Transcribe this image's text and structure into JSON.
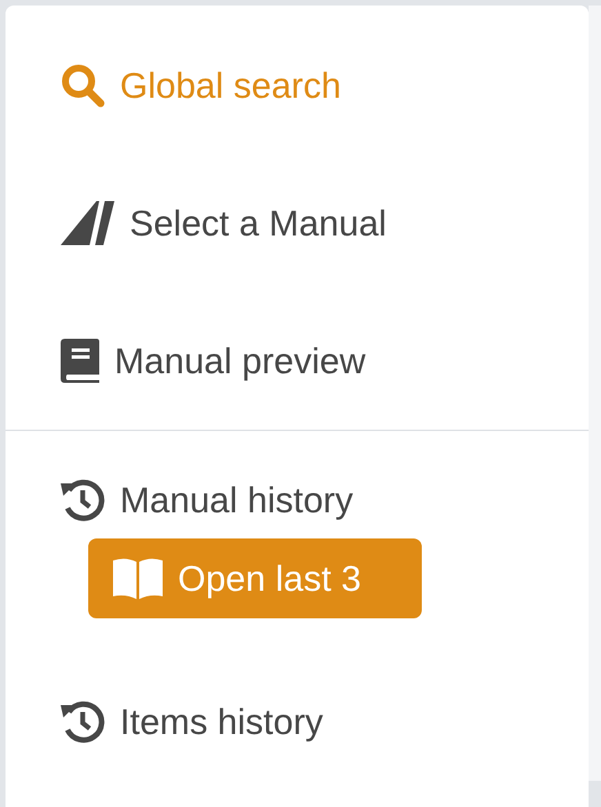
{
  "menu": {
    "groups": [
      {
        "items": [
          {
            "kind": "search",
            "label": "Global search",
            "selected": true
          },
          {
            "kind": "select",
            "label": "Select a Manual",
            "selected": false
          },
          {
            "kind": "preview",
            "label": "Manual preview",
            "selected": false
          }
        ]
      },
      {
        "items": [
          {
            "kind": "history",
            "label": "Manual history",
            "selected": false,
            "action": {
              "kind": "book",
              "label": "Open last 3"
            }
          },
          {
            "kind": "history",
            "label": "Items history",
            "selected": false
          }
        ]
      }
    ]
  }
}
